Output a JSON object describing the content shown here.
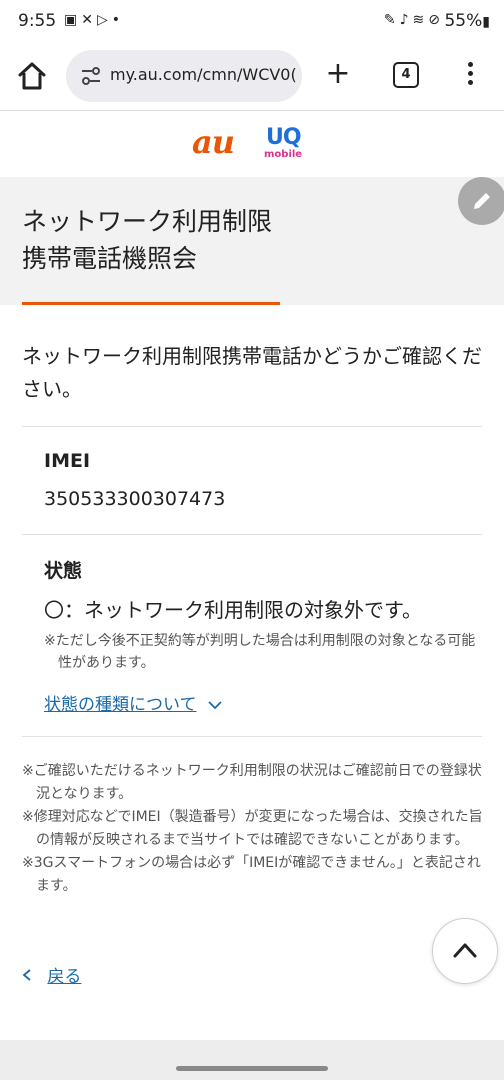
{
  "status_bar": {
    "time": "9:55",
    "left_icons": [
      "image-icon",
      "tools-icon",
      "play-store-icon",
      "dot-icon"
    ],
    "right_icons": [
      "pen-icon",
      "mute-icon",
      "wifi-icon",
      "block-icon"
    ],
    "battery": "55%"
  },
  "browser": {
    "url": "my.au.com/cmn/WCV0(",
    "tab_count": "4"
  },
  "logos": {
    "au": "au",
    "uq": "UQ",
    "uq_sub": "mobile"
  },
  "page": {
    "title_line1": "ネットワーク利用制限",
    "title_line2": "携帯電話機照会",
    "intro": "ネットワーク利用制限携帯電話かどうかご確認ください。"
  },
  "imei": {
    "label": "IMEI",
    "value": "350533300307473"
  },
  "status": {
    "label": "状態",
    "result": "〇：ネットワーク利用制限の対象外です。",
    "note": "※ただし今後不正契約等が判明した場合は利用制限の対象となる可能性があります。",
    "link": "状態の種類について"
  },
  "notes": [
    "※ご確認いただけるネットワーク利用制限の状況はご確認前日での登録状況となります。",
    "※修理対応などでIMEI（製造番号）が変更になった場合は、交換された旨の情報が反映されるまで当サイトでは確認できないことがあります。",
    "※3Gスマートフォンの場合は必ず「IMEIが確認できません。」と表記されます。"
  ],
  "back": {
    "label": "戻る"
  },
  "colors": {
    "accent": "#eb5505",
    "link": "#1a6aa8",
    "band": "#f2f2f2"
  }
}
